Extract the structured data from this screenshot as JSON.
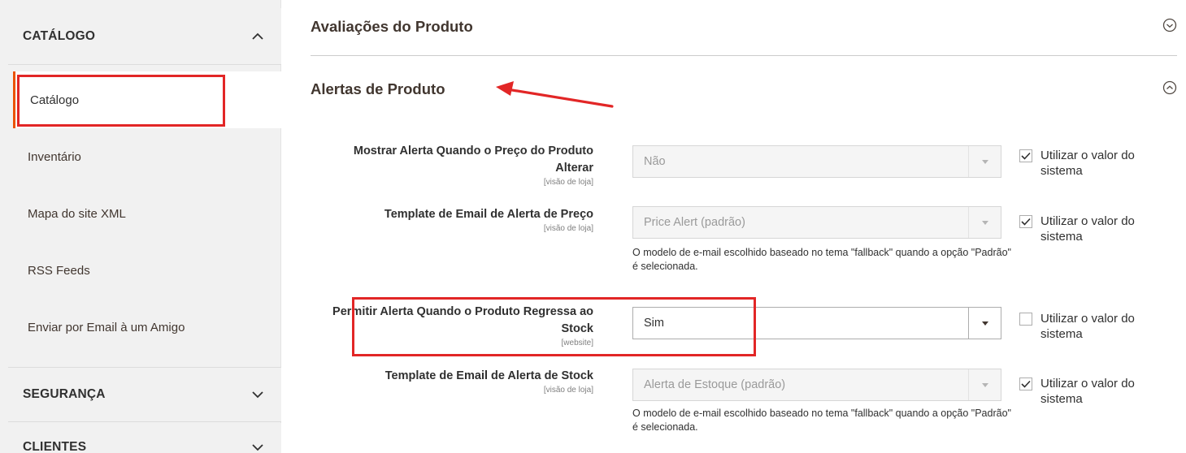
{
  "sidebar": {
    "catalog_section": {
      "label": "CATÁLOGO",
      "expanded": true
    },
    "items": [
      {
        "label": "Catálogo",
        "active": true
      },
      {
        "label": "Inventário"
      },
      {
        "label": "Mapa do site XML"
      },
      {
        "label": "RSS Feeds"
      },
      {
        "label": "Enviar por Email à um Amigo"
      }
    ],
    "security_section": {
      "label": "SEGURANÇA",
      "expanded": false
    },
    "customers_section": {
      "label": "CLIENTES",
      "expanded": false
    }
  },
  "main": {
    "groups": [
      {
        "title": "Avaliações do Produto",
        "expanded": false
      },
      {
        "title": "Alertas de Produto",
        "expanded": true
      }
    ],
    "fields": [
      {
        "label": "Mostrar Alerta Quando o Preço do Produto Alterar",
        "scope": "[visão de loja]",
        "value": "Não",
        "disabled": true,
        "note": "",
        "use_system_label": "Utilizar o valor do sistema",
        "use_system_checked": true
      },
      {
        "label": "Template de Email de Alerta de Preço",
        "scope": "[visão de loja]",
        "value": "Price Alert (padrão)",
        "disabled": true,
        "note": "O modelo de e-mail escolhido baseado no tema \"fallback\" quando a opção \"Padrão\" é selecionada.",
        "use_system_label": "Utilizar o valor do sistema",
        "use_system_checked": true
      },
      {
        "label": "Permitir Alerta Quando o Produto Regressa ao Stock",
        "scope": "[website]",
        "value": "Sim",
        "disabled": false,
        "note": "",
        "use_system_label": "Utilizar o valor do sistema",
        "use_system_checked": false
      },
      {
        "label": "Template de Email de Alerta de Stock",
        "scope": "[visão de loja]",
        "value": "Alerta de Estoque (padrão)",
        "disabled": true,
        "note": "O modelo de e-mail escolhido baseado no tema \"fallback\" quando a opção \"Padrão\" é selecionada.",
        "use_system_label": "Utilizar o valor do sistema",
        "use_system_checked": true
      }
    ]
  },
  "colors": {
    "annotation_red": "#e22626",
    "active_accent": "#eb5202",
    "sidebar_bg": "#f1f1f1"
  },
  "icons": {
    "section_expanded": "chevron-up-icon",
    "section_collapsed": "chevron-down-icon",
    "group_toggle": "circle-chevron-icon",
    "select_caret": "caret-down-icon",
    "checkbox_mark": "check-icon"
  }
}
